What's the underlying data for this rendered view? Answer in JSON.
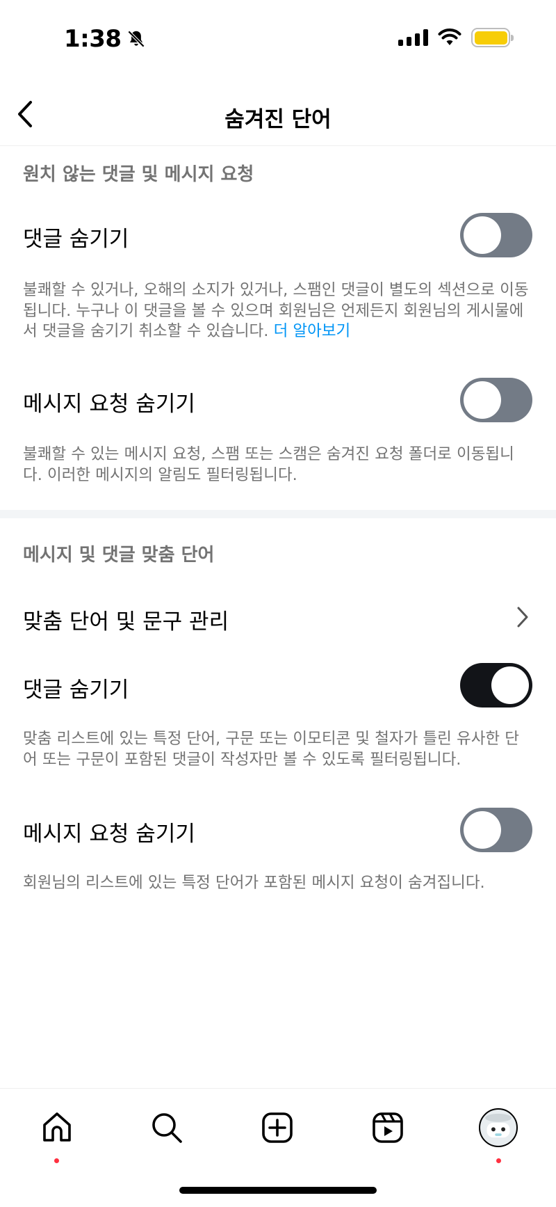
{
  "status_bar": {
    "time": "1:38"
  },
  "header": {
    "title": "숨겨진 단어"
  },
  "section1": {
    "header": "원치 않는 댓글 및 메시지 요청",
    "hide_comments": {
      "label": "댓글 숨기기",
      "enabled": false,
      "description": "불쾌할 수 있거나, 오해의 소지가 있거나, 스팸인 댓글이 별도의 섹션으로 이동됩니다. 누구나 이 댓글을 볼 수 있으며 회원님은 언제든지 회원님의 게시물에서 댓글을 숨기기 취소할 수 있습니다.",
      "learn_more": "더 알아보기"
    },
    "hide_message_requests": {
      "label": "메시지 요청 숨기기",
      "enabled": false,
      "description": "불쾌할 수 있는 메시지 요청, 스팸 또는 스캠은 숨겨진 요청 폴더로 이동됩니다. 이러한 메시지의 알림도 필터링됩니다."
    }
  },
  "section2": {
    "header": "메시지 및 댓글 맞춤 단어",
    "manage_label": "맞춤 단어 및 문구 관리",
    "hide_comments": {
      "label": "댓글 숨기기",
      "enabled": true,
      "description": "맞춤 리스트에 있는 특정 단어, 구문 또는 이모티콘 및 철자가 틀린 유사한 단어 또는 구문이 포함된 댓글이 작성자만 볼 수 있도록 필터링됩니다."
    },
    "hide_message_requests": {
      "label": "메시지 요청 숨기기",
      "enabled": false,
      "description": "회원님의 리스트에 있는 특정 단어가 포함된 메시지 요청이 숨겨집니다."
    }
  },
  "tab_bar": {
    "items": [
      "home-icon",
      "search-icon",
      "create-icon",
      "reels-icon",
      "profile-avatar"
    ],
    "notification_color": "#ff3040"
  },
  "colors": {
    "link": "#0095f6",
    "toggle_off": "#737b86",
    "toggle_on": "#121418",
    "battery": "#f7cd07"
  }
}
